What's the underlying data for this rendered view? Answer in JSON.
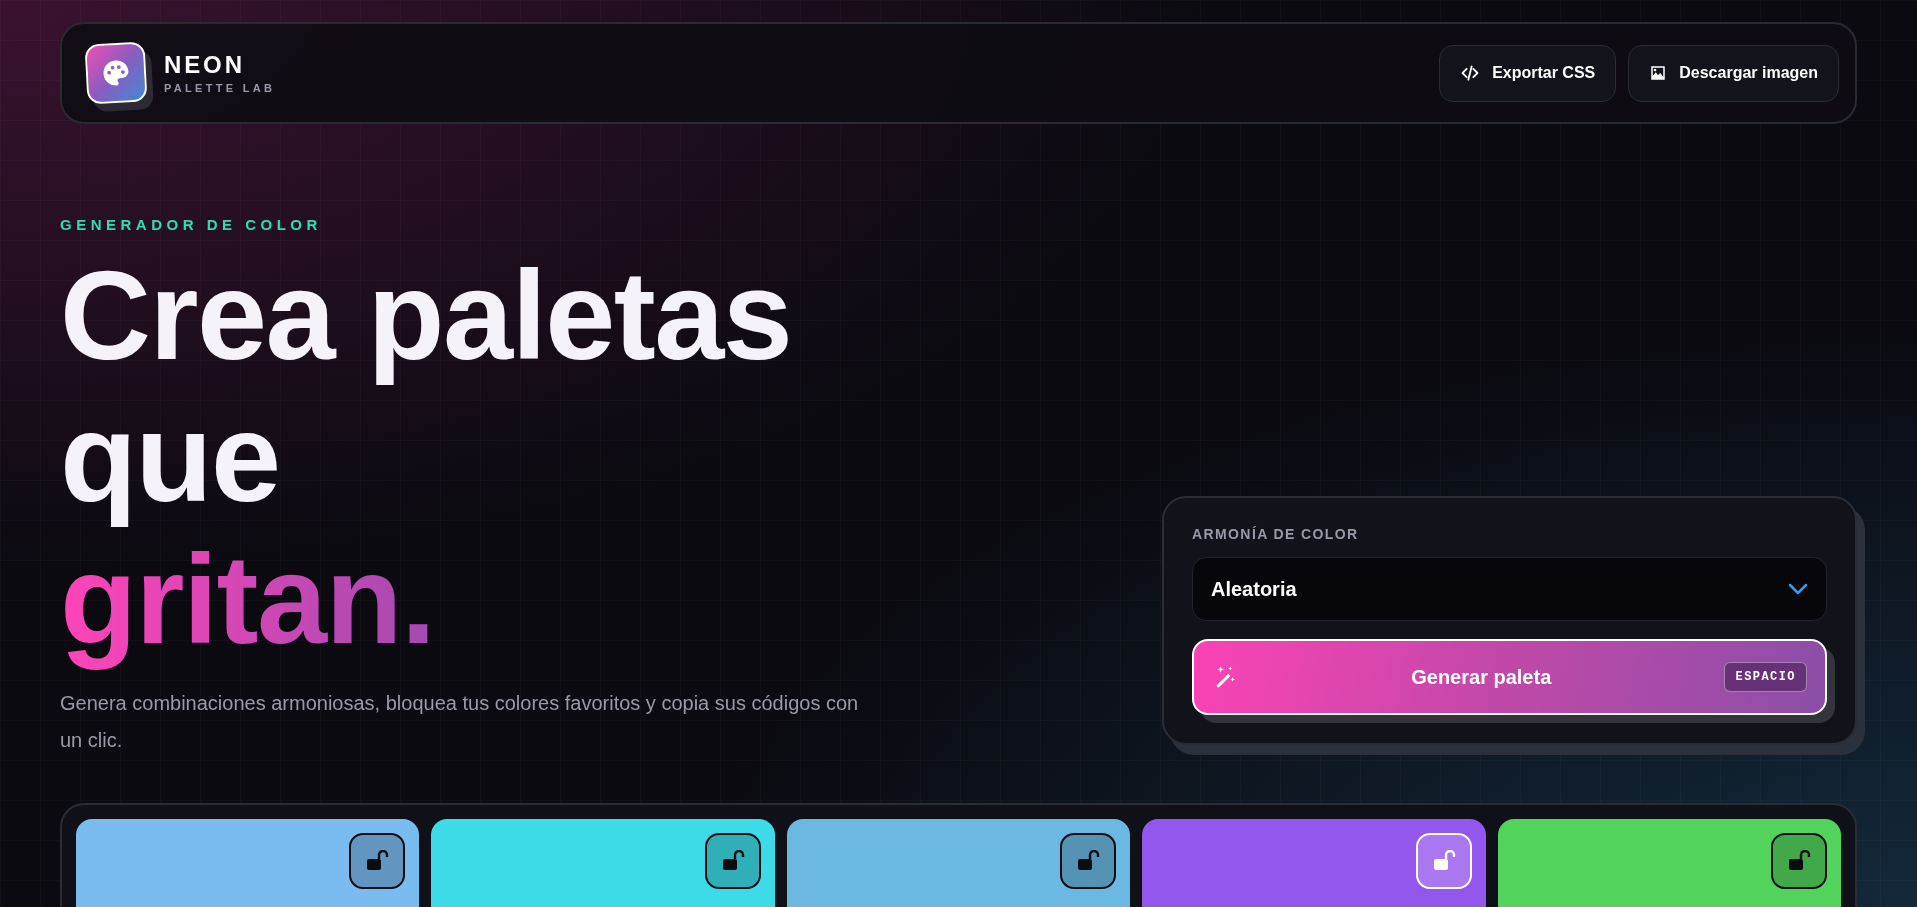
{
  "brand": {
    "name": "NEON",
    "tagline": "PALETTE LAB"
  },
  "header_buttons": [
    {
      "label": "Exportar CSS",
      "kind": "code"
    },
    {
      "label": "Descargar imagen",
      "kind": "image"
    }
  ],
  "hero": {
    "eyebrow": "GENERADOR DE COLOR",
    "title_lines": [
      "Crea paletas",
      "que"
    ],
    "title_highlight": "gritan.",
    "description": "Genera combinaciones armoniosas, bloquea tus colores favoritos y copia sus códigos con un clic."
  },
  "harmony_panel": {
    "label": "ARMONÍA DE COLOR",
    "value": "Aleatoria",
    "generate_button": "Generar paleta",
    "shortcut": "ESPACIO"
  },
  "swatches": [
    {
      "color": "#7bbcf0",
      "locked": false
    },
    {
      "color": "#3ddbe8",
      "locked": false
    },
    {
      "color": "#6bb8e3",
      "locked": false
    },
    {
      "color": "#9457ee",
      "locked": false
    },
    {
      "color": "#52d45c",
      "locked": false
    }
  ]
}
